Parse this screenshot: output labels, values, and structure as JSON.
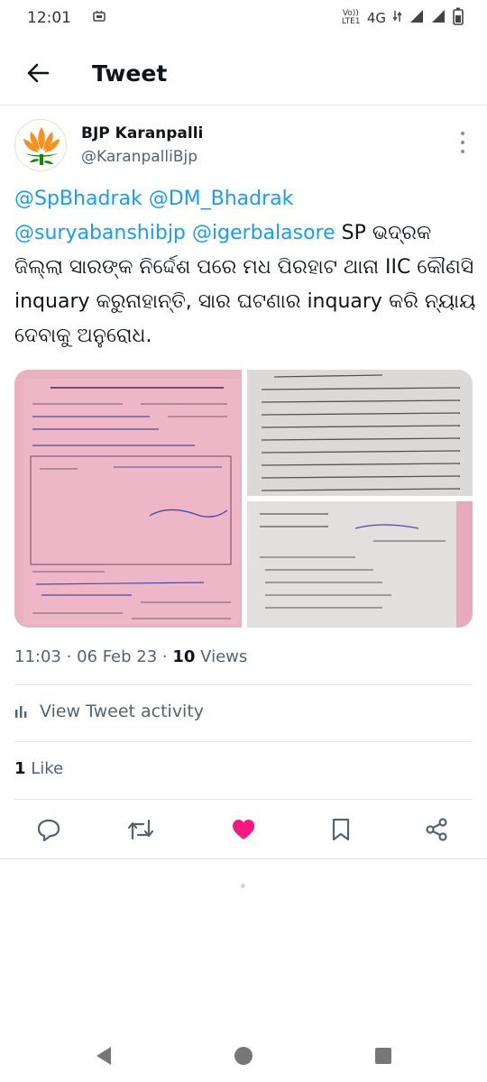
{
  "status_bar": {
    "time": "12:01",
    "network": "4G",
    "volte": "Vo)) LTE1"
  },
  "app_bar": {
    "title": "Tweet"
  },
  "author": {
    "name": "BJP Karanpalli",
    "handle": "@KaranpalliBjp"
  },
  "tweet": {
    "mentions": [
      "@SpBhadrak",
      "@DM_Bhadrak",
      "@suryabanshibjp",
      "@igerbalasore"
    ],
    "text_line1_tail": "SP ଭଦ୍ରକ",
    "text_rest": "ଜିଲ୍ଲା ସାରଙ୍କ ନିର୍ଦ୍ଦେଶ ପରେ ମଧ ପିରହାଟ ଥାନା IIC କୌଣସି inquary କରୁନାହାନ୍ତି, ସାର ଘଟଣାର inquary କରି ନ୍ୟାୟ ଦେବାକୁ ଅନୁରୋଧ."
  },
  "meta": {
    "time": "11:03",
    "date": "06 Feb 23",
    "views_count": "10",
    "views_label": "Views"
  },
  "activity": {
    "label": "View Tweet activity"
  },
  "likes": {
    "count": "1",
    "label": "Like"
  },
  "icons": {
    "back": "arrow-left-icon",
    "more": "more-vertical-icon",
    "reply": "reply-icon",
    "retweet": "retweet-icon",
    "like": "heart-icon",
    "bookmark": "bookmark-icon",
    "share": "share-icon",
    "analytics": "bar-chart-icon"
  },
  "colors": {
    "link": "#1d9bf0",
    "like": "#f91880",
    "muted": "#536471",
    "text": "#0f1419"
  }
}
